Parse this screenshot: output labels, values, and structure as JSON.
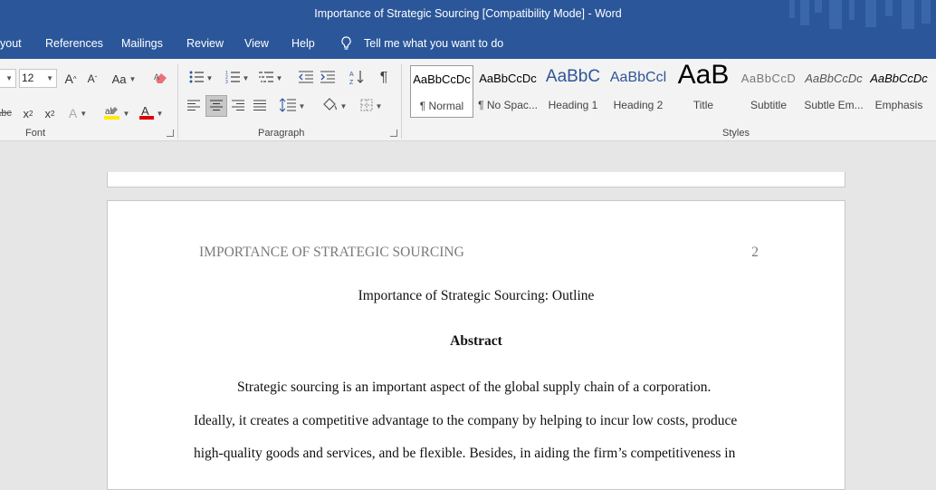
{
  "window": {
    "title": "Importance of Strategic Sourcing [Compatibility Mode]  -  Word"
  },
  "tabs": [
    "yout",
    "References",
    "Mailings",
    "Review",
    "View",
    "Help"
  ],
  "tell_me": "Tell me what you want to do",
  "font": {
    "size": "12",
    "group_label": "Font",
    "grow_label": "A",
    "shrink_label": "A",
    "case_label": "Aa"
  },
  "paragraph": {
    "group_label": "Paragraph"
  },
  "styles": {
    "group_label": "Styles",
    "items": [
      {
        "preview": "AaBbCcDc",
        "name": "¶ Normal"
      },
      {
        "preview": "AaBbCcDc",
        "name": "¶ No Spac..."
      },
      {
        "preview": "AaBbC",
        "name": "Heading 1"
      },
      {
        "preview": "AaBbCcl",
        "name": "Heading 2"
      },
      {
        "preview": "AaB",
        "name": "Title"
      },
      {
        "preview": "AaBbCcD",
        "name": "Subtitle"
      },
      {
        "preview": "AaBbCcDc",
        "name": "Subtle Em..."
      },
      {
        "preview": "AaBbCcDc",
        "name": "Emphasis"
      }
    ]
  },
  "document": {
    "running_head": "IMPORTANCE OF STRATEGIC SOURCING",
    "page_number": "2",
    "title": "Importance of Strategic Sourcing: Outline",
    "abstract_heading": "Abstract",
    "lines": [
      "Strategic sourcing is an important aspect of the global supply chain of a corporation.",
      "Ideally, it creates a competitive advantage to the company by helping to incur low costs, produce",
      "high-quality goods and services, and be flexible. Besides, in aiding the firm’s competitiveness in"
    ]
  },
  "colors": {
    "accent": "#2b579a",
    "ribbon": "#f3f3f3",
    "workspace": "#e6e6e6"
  }
}
